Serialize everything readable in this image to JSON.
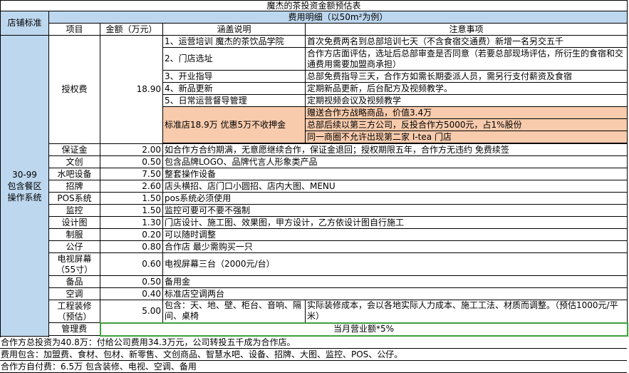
{
  "title": "魔杰的茶投资金额预估表",
  "subheader": "费用明细（以50m²为例）",
  "store_standard": "店铺标准",
  "store_type": "30-99\n包含餐区\n操作系统",
  "columns": {
    "item": "项目",
    "amount": "金额（万元）",
    "desc": "涵盖说明",
    "note": "注意事项"
  },
  "license": {
    "name": "授权费",
    "amount": "18.90",
    "sub": [
      {
        "desc": "1、运营培训 魔杰的茶饮品学院",
        "note": "首次免费两名到总部培训七天（不含食宿交通费）新增一名另交五千"
      },
      {
        "desc": "2、门店选址",
        "note": "合作方店面评估，选址后总部审查是否同意（若要总部现场评估，所衍生的食宿和交通费用需要加盟商承担）"
      },
      {
        "desc": "3、开业指导",
        "note": "总部免费指导三天，合作方如需长期委派人员，需另行支付薪资及食宿"
      },
      {
        "desc": "4、新品更新",
        "note": "定期新品更新，后台配方及视频教学。"
      },
      {
        "desc": "5、日常运营督导管理",
        "note": "定期视频会议及视频教学"
      }
    ],
    "promo": "标准店18.9万 优惠5万不收押金",
    "promo_notes": [
      "赠送合作方战略商品，价值3.4万",
      "总部后续以第三方公司，反投合作方5000元，占1%股份",
      "同一商圈不允许出现第二家  I-tea 门店"
    ]
  },
  "rows": [
    {
      "name": "保证金",
      "amount": "2.00",
      "desc": "如合作方合约期满，无意愿继续合作，保证金退回；授权期限五年，合作方无违约  免费续签"
    },
    {
      "name": "文创",
      "amount": "0.50",
      "desc": "包含品牌LOGO、品牌代言人形象类产品"
    },
    {
      "name": "水吧设备",
      "amount": "7.50",
      "desc": "整套操作设备"
    },
    {
      "name": "招牌",
      "amount": "2.60",
      "desc": "店头横招、店门口小圆招、店内大图、MENU"
    },
    {
      "name": "POS系统",
      "amount": "1.50",
      "desc": " pos系统必须使用"
    },
    {
      "name": "监控",
      "amount": "1.50",
      "desc": "监控可要可不要不强制"
    },
    {
      "name": "设计图",
      "amount": "1.30",
      "desc": "门店设计、施工图、效果图，甲方设计，乙方依设计图自行施工"
    },
    {
      "name": "制服",
      "amount": "0.20",
      "desc": "可以随时调整"
    },
    {
      "name": "公仔",
      "amount": "0.80",
      "desc": "合作店 最少需购买一只"
    }
  ],
  "tv": {
    "name": "电视屏幕\n（55寸）",
    "amount": "0.60",
    "desc": "电视屏幕三台（2000元/台）"
  },
  "spare": {
    "name": "备品",
    "amount": "0.50",
    "desc": "备用金"
  },
  "ac": {
    "name": "空调",
    "amount": "0.40",
    "desc": "标准店空调两台"
  },
  "decor": {
    "name": "工程装修\n（预估）",
    "amount": "5.00",
    "desc": "包含：天、地、壁、柜台、音响、隔间、桌椅",
    "note": "实际装修成本，会以各地实际人力成本、施工工法、材质而调整。（预估1000元/平米）"
  },
  "mgmt": {
    "name": "管理费",
    "desc": "当月营业额*5%"
  },
  "footer": [
    "合作方总投资为40.8万：付给公司费用34.3万元，公司转投五千成为合作店。",
    "费用包含：加盟费、食材、包材、新零售、文创商品、智慧水吧、设备、招牌、大图、监控、POS、公仔。",
    "合作方自付费：6.5万 包含装修、电视、空调、备用"
  ],
  "colors": {
    "header_blue": "#bdd7ee",
    "promo_peach": "#f8cbad",
    "mgmt_border": "#3f9f3f"
  }
}
